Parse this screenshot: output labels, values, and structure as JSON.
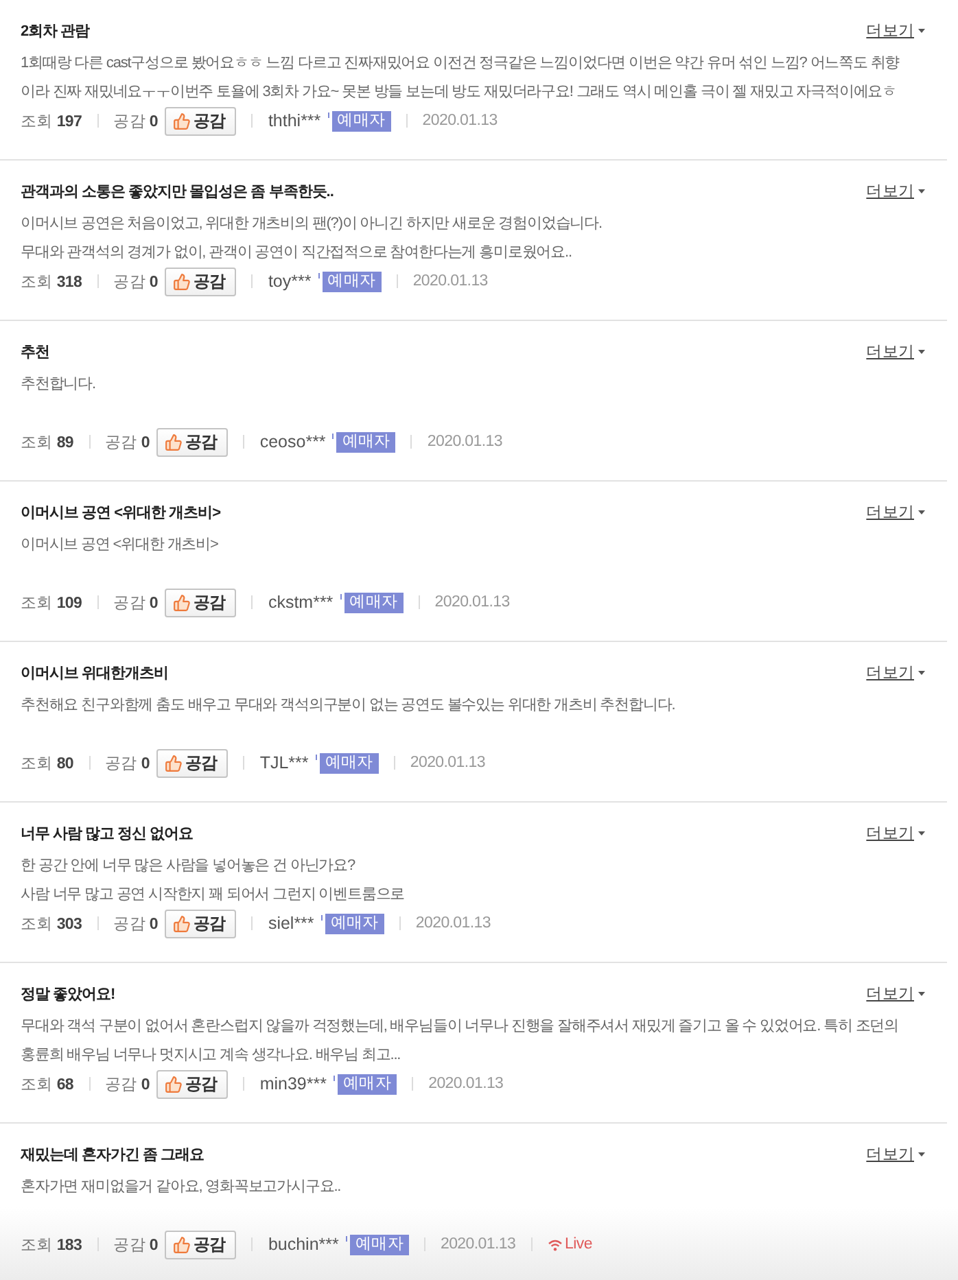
{
  "reviews": [
    {
      "title": "2회차 관람",
      "more": "더보기",
      "body": [
        "1회때랑 다른 cast구성으로 봤어요ㅎㅎ 느낌 다르고 진짜재밌어요 이전건 정극같은 느낌이었다면 이번은 약간 유머 섞인 느낌? 어느쪽도 취향",
        "이라 진짜 재밌네요ㅜㅜ이번주 토욜에 3회차 가요~ 못본 방들 보는데 방도 재밌더라구요! 그래도 역시 메인홀 극이 젤 재밌고 자극적이에요ㅎ"
      ],
      "views_label": "조회",
      "views": "197",
      "likes_label": "공감",
      "likes": "0",
      "like_button": "공감",
      "user": "ththi***",
      "badge": "예매자",
      "date": "2020.01.13"
    },
    {
      "title": "관객과의 소통은 좋았지만 몰입성은 좀 부족한듯..",
      "more": "더보기",
      "body": [
        "이머시브 공연은 처음이었고, 위대한 개츠비의 팬(?)이 아니긴 하지만 새로운 경험이었습니다.",
        "무대와 관객석의 경계가 없이, 관객이 공연이 직간접적으로 참여한다는게 흥미로웠어요.."
      ],
      "views_label": "조회",
      "views": "318",
      "likes_label": "공감",
      "likes": "0",
      "like_button": "공감",
      "user": "toy***",
      "badge": "예매자",
      "date": "2020.01.13"
    },
    {
      "title": "추천",
      "more": "더보기",
      "body": [
        "추천합니다."
      ],
      "views_label": "조회",
      "views": "89",
      "likes_label": "공감",
      "likes": "0",
      "like_button": "공감",
      "user": "ceoso***",
      "badge": "예매자",
      "date": "2020.01.13"
    },
    {
      "title": "이머시브 공연 <위대한 개츠비>",
      "more": "더보기",
      "body": [
        "이머시브 공연 <위대한 개츠비>"
      ],
      "views_label": "조회",
      "views": "109",
      "likes_label": "공감",
      "likes": "0",
      "like_button": "공감",
      "user": "ckstm***",
      "badge": "예매자",
      "date": "2020.01.13"
    },
    {
      "title": "이머시브 위대한개츠비",
      "more": "더보기",
      "body": [
        "추천해요 친구와함께 춤도 배우고 무대와 객석의구분이 없는 공연도 볼수있는 위대한 개츠비 추천합니다."
      ],
      "views_label": "조회",
      "views": "80",
      "likes_label": "공감",
      "likes": "0",
      "like_button": "공감",
      "user": "TJL***",
      "badge": "예매자",
      "date": "2020.01.13"
    },
    {
      "title": "너무 사람 많고 정신 없어요",
      "more": "더보기",
      "body": [
        "한 공간 안에 너무 많은 사람을 넣어놓은 건 아닌가요?",
        "사람 너무 많고 공연 시작한지 꽤 되어서 그런지 이벤트룸으로"
      ],
      "views_label": "조회",
      "views": "303",
      "likes_label": "공감",
      "likes": "0",
      "like_button": "공감",
      "user": "siel***",
      "badge": "예매자",
      "date": "2020.01.13"
    },
    {
      "title": "정말 좋았어요!",
      "more": "더보기",
      "body": [
        "무대와 객석 구분이 없어서 혼란스럽지 않을까 걱정했는데, 배우님들이 너무나 진행을 잘해주셔서 재밌게 즐기고 올 수 있었어요. 특히 조던의",
        "홍륜희 배우님 너무나 멋지시고 계속 생각나요. 배우님 최고..."
      ],
      "views_label": "조회",
      "views": "68",
      "likes_label": "공감",
      "likes": "0",
      "like_button": "공감",
      "user": "min39***",
      "badge": "예매자",
      "date": "2020.01.13"
    },
    {
      "title": "재밌는데 혼자가긴 좀 그래요",
      "more": "더보기",
      "body": [
        "혼자가면 재미없을거 같아요, 영화꼭보고가시구요.."
      ],
      "views_label": "조회",
      "views": "183",
      "likes_label": "공감",
      "likes": "0",
      "like_button": "공감",
      "user": "buchin***",
      "badge": "예매자",
      "date": "2020.01.13",
      "live": "Live"
    }
  ]
}
